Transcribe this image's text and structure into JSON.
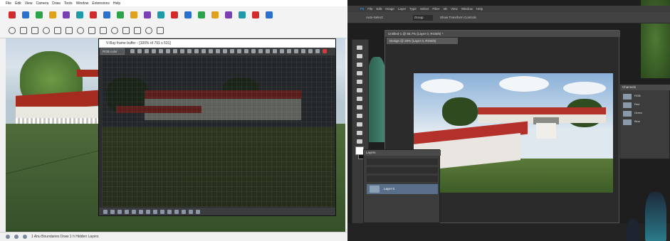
{
  "sketchup": {
    "menu": [
      "File",
      "Edit",
      "View",
      "Camera",
      "Draw",
      "Tools",
      "Window",
      "Extensions",
      "Help"
    ],
    "status_text": "1 Anu Boundaries Draw 1 h Hidden Layers",
    "toolbar_icons": [
      "select-icon",
      "eraser-icon",
      "pencil-icon",
      "line-icon",
      "rectangle-icon",
      "push-pull-icon",
      "move-icon",
      "rotate-icon",
      "scale-icon",
      "offset-icon",
      "tape-icon",
      "paint-icon",
      "orbit-icon",
      "pan-icon",
      "zoom-icon",
      "zoom-extents-icon",
      "walk-icon",
      "section-icon",
      "component-icon",
      "materials-icon"
    ],
    "accent_colors": [
      "#d12b2b",
      "#2b6fd1",
      "#2ba34a",
      "#e0a21b",
      "#7b3fb5",
      "#1f9aa8"
    ]
  },
  "render_window": {
    "title": "V-Ray frame buffer - [100% of 791 x 531]",
    "channel_select": "RGB color"
  },
  "photoshop": {
    "menu": [
      "Ps",
      "File",
      "Edit",
      "Image",
      "Layer",
      "Type",
      "Select",
      "Filter",
      "3D",
      "View",
      "Window",
      "Help"
    ],
    "options_label": "Auto-Select:",
    "options_value": "Group",
    "options_extra": "Show Transform Controls",
    "doc_tab": "Untitled-1 @ 66.7% (Layer 0, RGB/8) *",
    "doc_tab2": "Design @ 25% (Layer 0, RGB/8)",
    "layers_title": "Layers",
    "layer_name": "Layer 0",
    "channels_title": "Channels",
    "channels": [
      "RGB",
      "Red",
      "Green",
      "Blue"
    ]
  }
}
